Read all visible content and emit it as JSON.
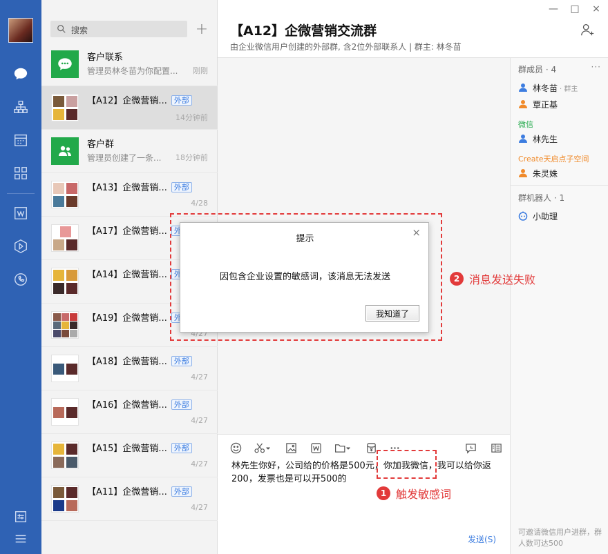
{
  "search": {
    "placeholder": "搜索"
  },
  "conversations": [
    {
      "name": "客户联系",
      "preview": "管理员林冬苗为你配置...",
      "time": "刚刚",
      "tag": ""
    },
    {
      "name": "【A12】企微营销...",
      "preview": "",
      "time": "14分钟前",
      "tag": "外部"
    },
    {
      "name": "客户群",
      "preview": "管理员创建了一条...",
      "time": "18分钟前",
      "tag": ""
    },
    {
      "name": "【A13】企微营销...",
      "preview": "",
      "time": "4/28",
      "tag": "外部"
    },
    {
      "name": "【A17】企微营销...",
      "preview": "",
      "time": "",
      "tag": "外"
    },
    {
      "name": "【A14】企微营销...",
      "preview": "",
      "time": "",
      "tag": "外"
    },
    {
      "name": "【A19】企微营销...",
      "preview": "",
      "time": "4/27",
      "tag": "外"
    },
    {
      "name": "【A18】企微营销...",
      "preview": "",
      "time": "4/27",
      "tag": "外部"
    },
    {
      "name": "【A16】企微营销...",
      "preview": "",
      "time": "4/27",
      "tag": "外部"
    },
    {
      "name": "【A15】企微营销...",
      "preview": "",
      "time": "4/27",
      "tag": "外部"
    },
    {
      "name": "【A11】企微营销...",
      "preview": "",
      "time": "4/27",
      "tag": "外部"
    }
  ],
  "header": {
    "title": "【A12】企微营销交流群",
    "subtitle": "由企业微信用户创建的外部群, 含2位外部联系人 | 群主: 林冬苗"
  },
  "window": {
    "minimize": "—",
    "maximize": "□",
    "close": "×"
  },
  "members": {
    "header": "群成员 · 4",
    "more": "···",
    "owner": {
      "name": "林冬苗",
      "role": "· 群主"
    },
    "member1": "覃正基",
    "group_wechat": "微信",
    "member2": "林先生",
    "group_create": "Create天启点子空间",
    "member3": "朱灵姝",
    "robots_header": "群机器人 · 1",
    "robot": "小助理",
    "footer": "可邀请微信用户进群，群人数可达500"
  },
  "composer": {
    "message": "林先生你好，公司给的价格是500元，你加我微信，我可以给你返200，发票也是可以开500的",
    "send_label": "发送(S)"
  },
  "dialog": {
    "title": "提示",
    "close": "×",
    "message": "因包含企业设置的敏感词，该消息无法发送",
    "ok_label": "我知道了"
  },
  "annotations": {
    "note1_num": "1",
    "note1_text": "触发敏感词",
    "note2_num": "2",
    "note2_text": "消息发送失败"
  },
  "colors": {
    "rail": "#2f62b4",
    "accent": "#3d7de0",
    "annotation": "#e23a3a",
    "green": "#22a94a"
  }
}
